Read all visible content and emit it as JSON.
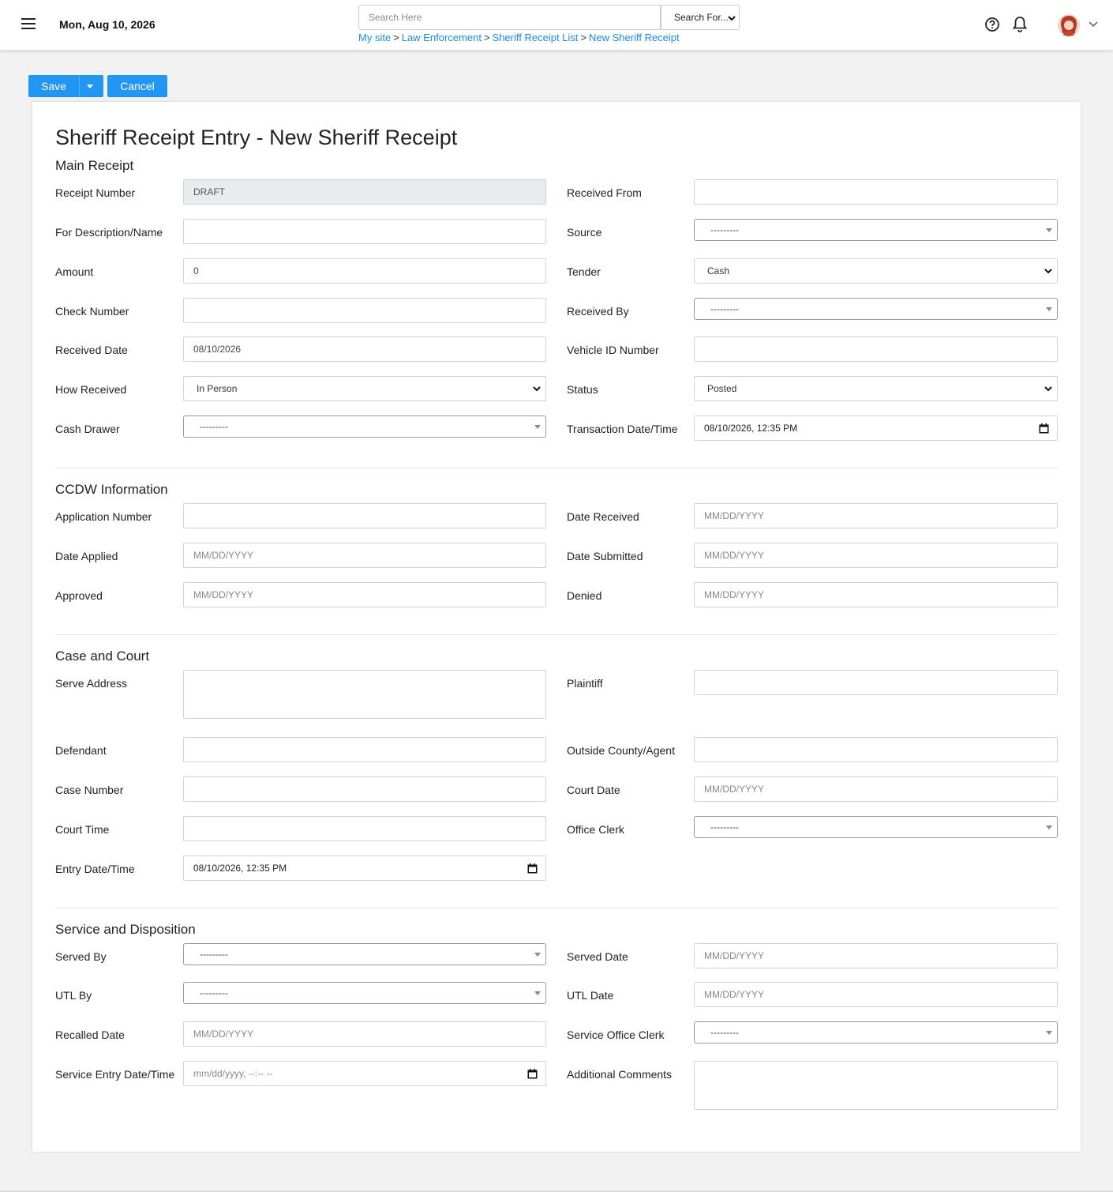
{
  "header": {
    "date": "Mon, Aug 10, 2026",
    "search_placeholder": "Search Here",
    "search_scope": "Search For...",
    "breadcrumb": [
      "My site",
      "Law Enforcement",
      "Sheriff Receipt List",
      "New Sheriff Receipt"
    ],
    "breadcrumb_separator": ">",
    "icons": [
      "menu-icon",
      "help-icon",
      "bell-icon",
      "avatar",
      "chevron-down-icon"
    ]
  },
  "toolbar": {
    "save_label": "Save",
    "cancel_label": "Cancel"
  },
  "page": {
    "title": "Sheriff Receipt Entry - New Sheriff Receipt"
  },
  "colors": {
    "accent": "#2196f3",
    "link": "#1e88e5",
    "readonly_bg": "#e9ecef"
  },
  "main_receipt": {
    "title": "Main Receipt",
    "receipt_number": {
      "label": "Receipt Number",
      "value": "DRAFT"
    },
    "for_description": {
      "label": "For Description/Name",
      "value": ""
    },
    "amount": {
      "label": "Amount",
      "value": "0"
    },
    "check_number": {
      "label": "Check Number",
      "value": ""
    },
    "received_date": {
      "label": "Received Date",
      "value": "08/10/2026"
    },
    "how_received": {
      "label": "How Received",
      "value": "In Person"
    },
    "cash_drawer": {
      "label": "Cash Drawer",
      "value": "---------"
    },
    "received_from": {
      "label": "Received From",
      "value": ""
    },
    "source": {
      "label": "Source",
      "value": "---------"
    },
    "tender": {
      "label": "Tender",
      "value": "Cash"
    },
    "received_by": {
      "label": "Received By",
      "value": "---------"
    },
    "vehicle_id": {
      "label": "Vehicle ID Number",
      "value": ""
    },
    "status": {
      "label": "Status",
      "value": "Posted"
    },
    "transaction_datetime": {
      "label": "Transaction Date/Time",
      "value": "08/10/2026, 12:35 PM"
    }
  },
  "ccdw": {
    "title": "CCDW Information",
    "application_number": {
      "label": "Application Number",
      "value": ""
    },
    "date_applied": {
      "label": "Date Applied",
      "placeholder": "MM/DD/YYYY"
    },
    "approved": {
      "label": "Approved",
      "placeholder": "MM/DD/YYYY"
    },
    "date_received": {
      "label": "Date Received",
      "placeholder": "MM/DD/YYYY"
    },
    "date_submitted": {
      "label": "Date Submitted",
      "placeholder": "MM/DD/YYYY"
    },
    "denied": {
      "label": "Denied",
      "placeholder": "MM/DD/YYYY"
    }
  },
  "case_court": {
    "title": "Case and Court",
    "serve_address": {
      "label": "Serve Address",
      "value": ""
    },
    "defendant": {
      "label": "Defendant",
      "value": ""
    },
    "case_number": {
      "label": "Case Number",
      "value": ""
    },
    "court_time": {
      "label": "Court Time",
      "value": ""
    },
    "entry_datetime": {
      "label": "Entry Date/Time",
      "value": "08/10/2026, 12:35 PM"
    },
    "plaintiff": {
      "label": "Plaintiff",
      "value": ""
    },
    "outside_county": {
      "label": "Outside County/Agent",
      "value": ""
    },
    "court_date": {
      "label": "Court Date",
      "placeholder": "MM/DD/YYYY"
    },
    "office_clerk": {
      "label": "Office Clerk",
      "value": "---------"
    }
  },
  "service": {
    "title": "Service and Disposition",
    "served_by": {
      "label": "Served By",
      "value": "---------"
    },
    "utl_by": {
      "label": "UTL By",
      "value": "---------"
    },
    "recalled_date": {
      "label": "Recalled Date",
      "placeholder": "MM/DD/YYYY"
    },
    "service_entry_datetime": {
      "label": "Service Entry Date/Time",
      "placeholder": "mm/dd/yyyy, --:-- --"
    },
    "served_date": {
      "label": "Served Date",
      "placeholder": "MM/DD/YYYY"
    },
    "utl_date": {
      "label": "UTL Date",
      "placeholder": "MM/DD/YYYY"
    },
    "service_office_clerk": {
      "label": "Service Office Clerk",
      "value": "---------"
    },
    "additional_comments": {
      "label": "Additional Comments",
      "value": ""
    }
  }
}
